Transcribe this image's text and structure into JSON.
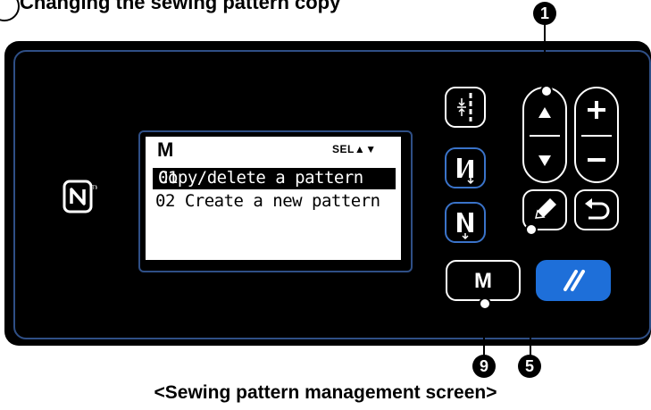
{
  "heading": {
    "text": "Changing the sewing pattern copy"
  },
  "panel": {
    "lcd": {
      "title": "M",
      "select_indicator": "SEL▲▼",
      "items": [
        {
          "number": "01",
          "label": "Copy/delete a pattern",
          "selected": true
        },
        {
          "number": "02",
          "label": "Create a new pattern",
          "selected": false
        }
      ]
    },
    "buttons": {
      "m_label": "M",
      "plus": "+",
      "minus": "−"
    }
  },
  "callouts": {
    "c1": "1",
    "c5": "5",
    "c9": "9"
  },
  "caption": "<Sewing pattern management screen>",
  "colors": {
    "panel": "#000000",
    "accent_border": "#2f4f86",
    "blue_button": "#1e6fd9"
  }
}
